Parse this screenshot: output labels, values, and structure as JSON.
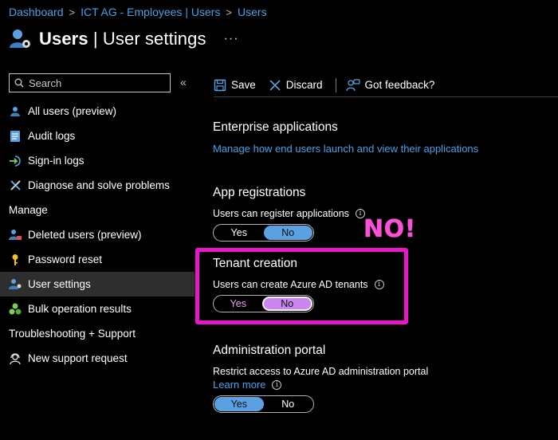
{
  "breadcrumb": [
    {
      "label": "Dashboard"
    },
    {
      "label": "ICT AG - Employees | Users"
    },
    {
      "label": "Users"
    }
  ],
  "breadcrumb_separator": ">",
  "header": {
    "title_bold": "Users",
    "title_rest": " | User settings",
    "more": "···"
  },
  "sidebar": {
    "search_placeholder": "Search",
    "collapse": "«",
    "top_items": [
      {
        "label": "All users (preview)",
        "icon": "user-icon"
      },
      {
        "label": "Audit logs",
        "icon": "audit-log-icon"
      },
      {
        "label": "Sign-in logs",
        "icon": "sign-in-icon"
      },
      {
        "label": "Diagnose and solve problems",
        "icon": "wrench-icon"
      }
    ],
    "manage_header": "Manage",
    "manage_items": [
      {
        "label": "Deleted users (preview)",
        "icon": "deleted-user-icon"
      },
      {
        "label": "Password reset",
        "icon": "key-icon"
      },
      {
        "label": "User settings",
        "icon": "user-settings-icon",
        "active": true
      },
      {
        "label": "Bulk operation results",
        "icon": "bulk-operations-icon"
      }
    ],
    "support_header": "Troubleshooting + Support",
    "support_items": [
      {
        "label": "New support request",
        "icon": "support-person-icon"
      }
    ]
  },
  "toolbar": {
    "save": "Save",
    "discard": "Discard",
    "feedback": "Got feedback?"
  },
  "enterprise": {
    "heading": "Enterprise applications",
    "link": "Manage how end users launch and view their applications"
  },
  "app_registrations": {
    "heading": "App registrations",
    "label": "Users can register applications",
    "yes": "Yes",
    "no": "No",
    "selected": "No"
  },
  "tenant": {
    "heading": "Tenant creation",
    "label": "Users can create Azure AD tenants",
    "yes": "Yes",
    "no": "No",
    "selected": "No",
    "callout": "NO!"
  },
  "admin_portal": {
    "heading": "Administration portal",
    "label": "Restrict access to Azure AD administration portal",
    "learn_more": "Learn more",
    "yes": "Yes",
    "no": "No",
    "selected": "Yes"
  },
  "colors": {
    "accent": "#4aa0e6",
    "highlight": "#ea14c8",
    "toggle_selected": "#5ba0e0",
    "toggle_selected_purple": "#c985f0"
  }
}
